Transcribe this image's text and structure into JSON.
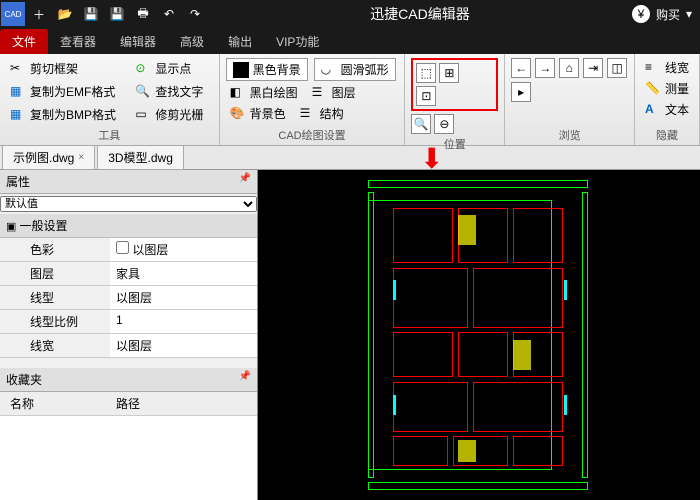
{
  "title": "迅捷CAD编辑器",
  "titlebar_right": {
    "buy": "购买"
  },
  "tabs": [
    "文件",
    "查看器",
    "编辑器",
    "高级",
    "输出",
    "VIP功能"
  ],
  "active_tab": 0,
  "ribbon": {
    "group_tool": {
      "label": "工具",
      "items": [
        "剪切框架",
        "复制为EMF格式",
        "复制为BMP格式",
        "显示点",
        "查找文字",
        "修剪光栅"
      ]
    },
    "group_cad": {
      "label": "CAD绘图设置",
      "items": [
        "黑色背景",
        "圆滑弧形",
        "黑白绘图",
        "图层",
        "背景色",
        "结构"
      ]
    },
    "group_pos": {
      "label": "位置"
    },
    "group_browse": {
      "label": "浏览"
    },
    "group_hide": {
      "label": "隐藏",
      "items": [
        "线宽",
        "测量",
        "文本"
      ]
    }
  },
  "doc_tabs": [
    "示例图.dwg",
    "3D模型.dwg"
  ],
  "panel": {
    "props_title": "属性",
    "default": "默认值",
    "general": "一般设置",
    "rows": [
      {
        "k": "色彩",
        "v": "以图层",
        "checkbox": true
      },
      {
        "k": "图层",
        "v": "家具"
      },
      {
        "k": "线型",
        "v": "以图层"
      },
      {
        "k": "线型比例",
        "v": "1"
      },
      {
        "k": "线宽",
        "v": "以图层"
      }
    ],
    "fav_title": "收藏夹",
    "fav_cols": [
      "名称",
      "路径"
    ]
  }
}
